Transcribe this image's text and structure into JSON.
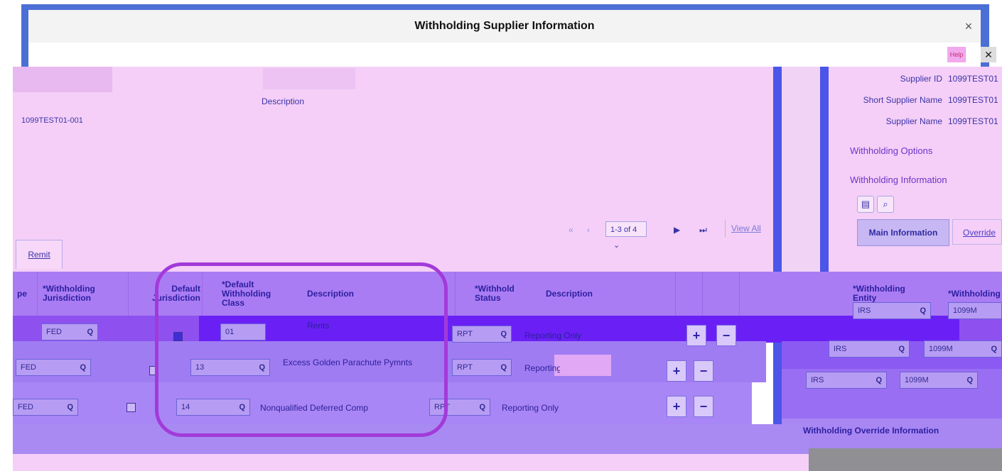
{
  "window": {
    "title": "Withholding Supplier Information",
    "close_label": "×"
  },
  "toolbar": {
    "help_label": "Help"
  },
  "main": {
    "description_label": "Description",
    "location_value": "1099TEST01-001"
  },
  "right_panel": {
    "fields": [
      {
        "label": "Supplier ID",
        "value": "1099TEST01"
      },
      {
        "label": "Short Supplier Name",
        "value": "1099TEST01"
      },
      {
        "label": "Supplier Name",
        "value": "1099TEST01"
      }
    ],
    "withholding_options": "Withholding Options",
    "withholding_information": "Withholding Information",
    "tabs": {
      "main": "Main Information",
      "override": "Override"
    },
    "col_entity": "*Withholding Entity",
    "col_withholding": "*Withholding",
    "rows": [
      {
        "entity": "IRS",
        "type": "1099M"
      },
      {
        "entity": "IRS",
        "type": "1099M"
      },
      {
        "entity": "IRS",
        "type": "1099M"
      }
    ],
    "bottom_label": "Withholding Override Information"
  },
  "pager": {
    "range": "1-3 of 4",
    "view_all": "View All"
  },
  "tabs": {
    "remit": "Remit"
  },
  "grid": {
    "headers": {
      "type": "pe",
      "jurisdiction": "*Withholding Jurisdiction",
      "default_jurisdiction": "Default Jurisdiction",
      "default_class": "*Default Withholding Class",
      "description": "Description",
      "status": "*Withhold Status",
      "status_description": "Description"
    },
    "rows": [
      {
        "jurisdiction": "FED",
        "default_jurisdiction": true,
        "class": "01",
        "class_description": "Rents",
        "status": "RPT",
        "status_description": "Reporting Only"
      },
      {
        "jurisdiction": "FED",
        "default_jurisdiction": false,
        "class": "13",
        "class_description": "Excess Golden Parachute Pymnts",
        "status": "RPT",
        "status_description": "Reporting Only"
      },
      {
        "jurisdiction": "FED",
        "default_jurisdiction": false,
        "class": "14",
        "class_description": "Nonqualified Deferred Comp",
        "status": "RPT",
        "status_description": "Reporting Only"
      }
    ],
    "add_label": "+",
    "remove_label": "−"
  },
  "colors": {
    "accent": "#4b55e8",
    "header": "#aa7cf3",
    "highlight": "#a23ad9",
    "panel": "#f5cff7"
  },
  "icons": [
    "close-icon",
    "search-icon",
    "grid-icon",
    "first-page-icon",
    "prev-page-icon",
    "next-page-icon",
    "last-page-icon",
    "chevron-down-icon",
    "plus-icon",
    "minus-icon"
  ]
}
